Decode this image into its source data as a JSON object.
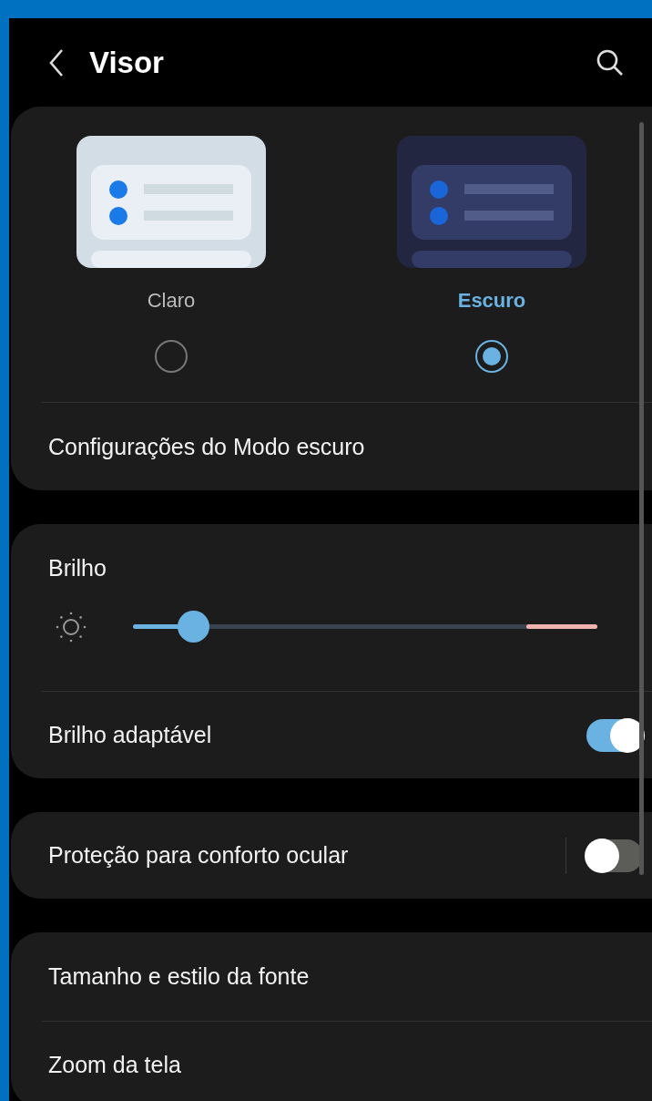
{
  "header": {
    "title": "Visor"
  },
  "themes": [
    {
      "label": "Claro",
      "kind": "light",
      "selected": false
    },
    {
      "label": "Escuro",
      "kind": "dark",
      "selected": true
    }
  ],
  "dark_mode_settings": {
    "label": "Configurações do Modo escuro"
  },
  "brightness": {
    "label": "Brilho",
    "level": 0.13
  },
  "adaptive_brightness": {
    "label": "Brilho adaptável",
    "on": true
  },
  "eye_comfort": {
    "label": "Proteção para conforto ocular",
    "on": false
  },
  "more_items": [
    {
      "label": "Tamanho e estilo da fonte"
    },
    {
      "label": "Zoom da tela"
    }
  ]
}
